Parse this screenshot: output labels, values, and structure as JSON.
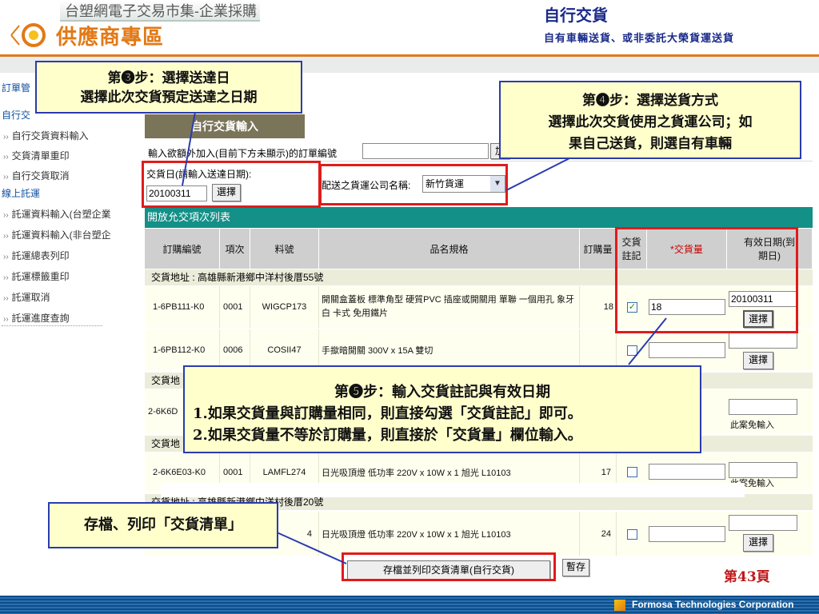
{
  "header": {
    "tab_title": "台塑網電子交易市集-企業採購",
    "brand": "供應商專區",
    "page_title": "自行交貨",
    "page_subtitle": "自有車輛送貨、或非委託大榮貨運送貨"
  },
  "sidebar": {
    "section1": "訂單管",
    "section2": "自行交",
    "items1": [
      "自行交貨資料輸入",
      "交貨清單重印",
      "自行交貨取消"
    ],
    "section3": "線上託運",
    "items2": [
      "託運資料輸入(台塑企業",
      "託運資料輸入(非台塑企",
      "託運總表列印",
      "託運標籤重印",
      "託運取消",
      "託運進度查詢"
    ]
  },
  "main": {
    "tab_label": "自行交貨輸入",
    "order_prompt": "輸入欲額外加入(目前下方未顯示)的訂單編號",
    "add_button": "加",
    "date_label": "交貨日(請輸入送達日期):",
    "date_value": "20100311",
    "select_button": "選擇",
    "carrier_label": "配送之貨運公司名稱:",
    "carrier_value": "新竹貨運",
    "list_title": "開放允交項次列表",
    "columns": [
      "訂購編號",
      "項次",
      "料號",
      "品名規格",
      "訂購量",
      "交貨\n註記",
      "*交貨量",
      "有效日期(到\n期日)"
    ],
    "address1": "交貨地址 : 高雄縣新港鄉中洋村後厝55號",
    "address2": "交貨地",
    "address3": "交貨地",
    "address4": "交貨地址 : 高雄縣新港鄉中洋村後厝20號",
    "rows": [
      {
        "order": "1-6PB111-K0",
        "item": "0001",
        "part": "WIGCP173",
        "desc": "開關盒蓋板 標準角型 硬質PVC 插座或開關用 單聯 一個用孔 象牙白 卡式 免用鐵片",
        "qty": "18",
        "checked": "✓",
        "deliver": "18",
        "valid": "20100311",
        "btn": "選擇"
      },
      {
        "order": "1-6PB112-K0",
        "item": "0006",
        "part": "COSII47",
        "desc": "手撳暗開關 300V x 15A 雙切",
        "qty": "",
        "checked": "",
        "deliver": "",
        "valid": "",
        "btn": "選擇"
      },
      {
        "order": "2-6K6D",
        "item": "",
        "part": "",
        "desc": "",
        "qty": "",
        "checked": "",
        "deliver": "",
        "valid": "",
        "btn": "此案免輸入"
      },
      {
        "order": "2-6K6E03-K0",
        "item": "0001",
        "part": "LAMFL274",
        "desc": "日光吸頂燈 低功率 220V x 10W x 1 旭光 L10103",
        "qty": "17",
        "checked": "",
        "deliver": "",
        "valid": "",
        "btn": "此案免輸入"
      },
      {
        "order": "",
        "item": "",
        "part": "4",
        "desc": "日光吸頂燈 低功率 220V x 10W x 1 旭光 L10103",
        "qty": "24",
        "checked": "",
        "deliver": "",
        "valid": "",
        "btn": "選擇"
      }
    ],
    "save_button": "存檔並列印交貨清單(自行交貨)",
    "temp_save_button": "暫存",
    "page_number": "第43頁"
  },
  "callouts": {
    "step3_line1": "第❸步：選擇送達日",
    "step3_line2": "選擇此次交貨預定送達之日期",
    "step4_line1": "第❹步：選擇送貨方式",
    "step4_line2": "選擇此次交貨使用之貨運公司；如",
    "step4_line3": "果自己送貨，則選自有車輛",
    "step5_title": "第❺步：輸入交貨註記與有效日期",
    "step5_line1": "1.如果交貨量與訂購量相同，則直接勾選「交貨註記」即可。",
    "step5_line2": "2.如果交貨量不等於訂購量，則直接於「交貨量」欄位輸入。",
    "save_note": "存檔、列印「交貨清單」"
  },
  "footer": {
    "company": "Formosa Technologies Corporation"
  },
  "colors": {
    "accent_orange": "#e27916",
    "teal": "#139088",
    "callout_border": "#2a3bb0",
    "highlight_red": "#e01b1b"
  }
}
